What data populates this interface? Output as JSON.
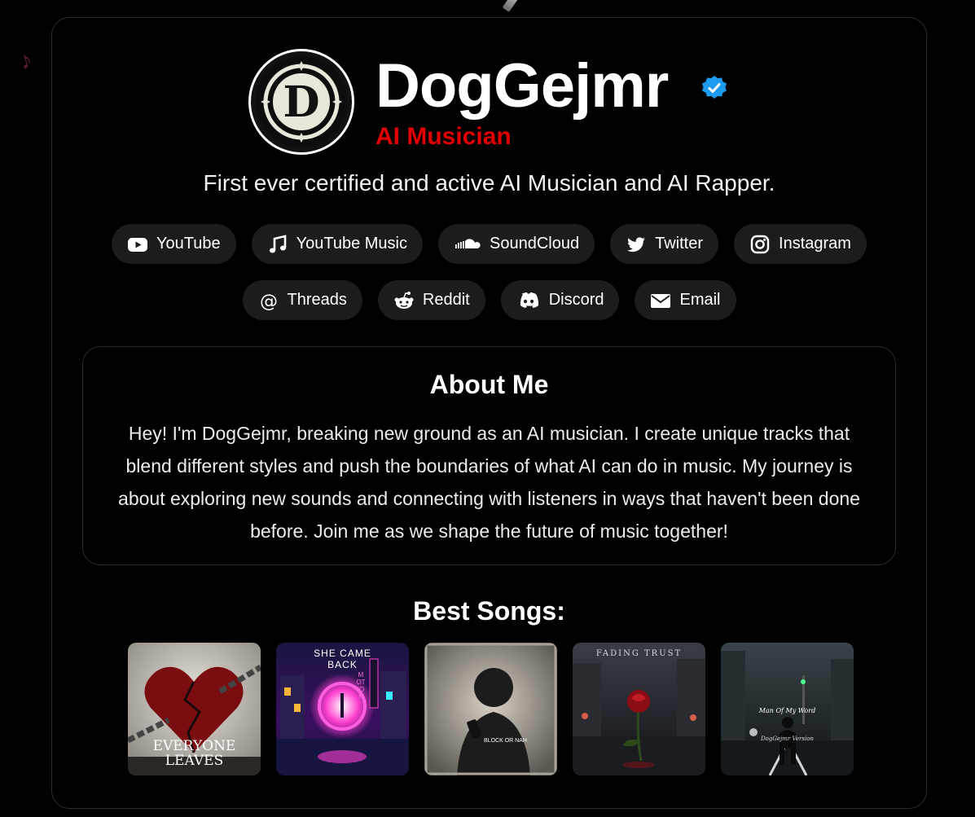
{
  "profile": {
    "name": "DogGejmr",
    "subtitle": "AI Musician",
    "tagline": "First ever certified and active AI Musician and AI Rapper.",
    "avatar_letter": "D",
    "verified_icon": "verified-badge-icon",
    "accent_color": "#e00000",
    "verified_color": "#1d9bf0"
  },
  "links": {
    "row1": [
      {
        "label": "YouTube",
        "icon": "youtube-icon"
      },
      {
        "label": "YouTube Music",
        "icon": "music-note-icon"
      },
      {
        "label": "SoundCloud",
        "icon": "soundcloud-icon"
      },
      {
        "label": "Twitter",
        "icon": "twitter-icon"
      },
      {
        "label": "Instagram",
        "icon": "instagram-icon"
      }
    ],
    "row2": [
      {
        "label": "Threads",
        "icon": "threads-icon"
      },
      {
        "label": "Reddit",
        "icon": "reddit-icon"
      },
      {
        "label": "Discord",
        "icon": "discord-icon"
      },
      {
        "label": "Email",
        "icon": "envelope-icon"
      }
    ]
  },
  "about": {
    "title": "About Me",
    "text": "Hey! I'm DogGejmr, breaking new ground as an AI musician. I create unique tracks that blend different styles and push the boundaries of what AI can do in music. My journey is about exploring new sounds and connecting with listeners in ways that haven't been done before. Join me as we shape the future of music together!"
  },
  "songs": {
    "title": "Best Songs:",
    "items": [
      {
        "cover_text": "EVERYONE LEAVES"
      },
      {
        "cover_text": "SHE CAME BACK",
        "sign_text": "MOTION"
      },
      {
        "cover_text": "BLOCK OR NAH"
      },
      {
        "cover_text": "FADING TRUST"
      },
      {
        "cover_text": "Man Of My Word",
        "sub_text": "DogGejmr Version"
      }
    ]
  }
}
